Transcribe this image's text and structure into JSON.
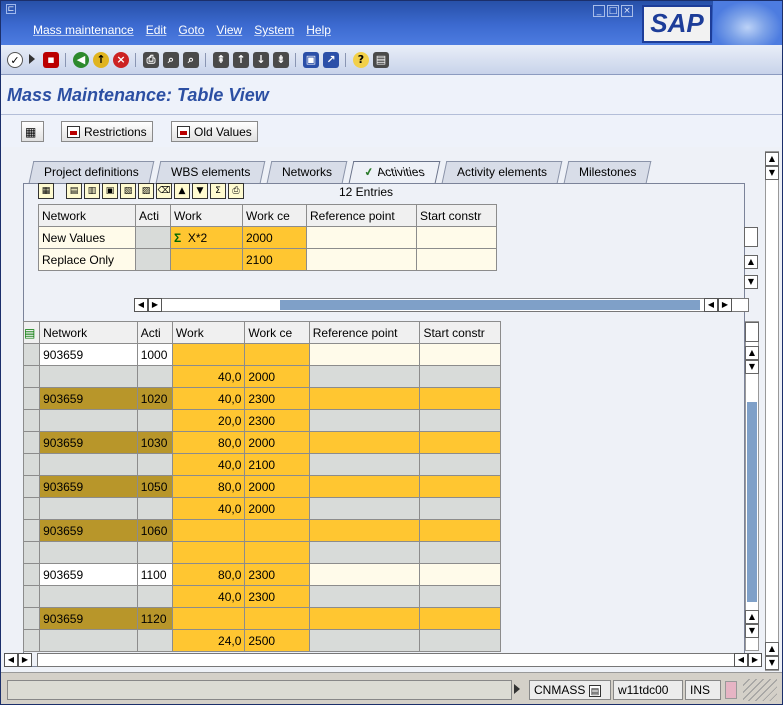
{
  "menu": [
    "Mass maintenance",
    "Edit",
    "Goto",
    "View",
    "System",
    "Help"
  ],
  "brand": "SAP",
  "page_title": "Mass Maintenance: Table View",
  "app_toolbar": {
    "restrictions": "Restrictions",
    "old_values": "Old Values"
  },
  "tabs": [
    "Project definitions",
    "WBS elements",
    "Networks",
    "Activities",
    "Activity elements",
    "Milestones"
  ],
  "active_tab": "Activities",
  "entries_label": "12  Entries",
  "new_values_table": {
    "columns": [
      "Network",
      "Acti",
      "Work",
      "Work ce",
      "Reference point",
      "Start constr"
    ],
    "rows": [
      {
        "label": "New Values",
        "work": "X*2",
        "work_center": "2000"
      },
      {
        "label": "Replace Only",
        "work": "",
        "work_center": "2100"
      }
    ]
  },
  "main_table": {
    "columns": [
      "Network",
      "Acti",
      "Work",
      "Work ce",
      "Reference point",
      "Start constr"
    ],
    "rows": [
      {
        "network": "903659",
        "activity": "1000",
        "work": "",
        "work_center": "",
        "style": "light"
      },
      {
        "network": "",
        "activity": "",
        "work": "40,0",
        "work_center": "2000",
        "style": "gray"
      },
      {
        "network": "903659",
        "activity": "1020",
        "work": "40,0",
        "work_center": "2300",
        "style": "gold"
      },
      {
        "network": "",
        "activity": "",
        "work": "20,0",
        "work_center": "2300",
        "style": "gray"
      },
      {
        "network": "903659",
        "activity": "1030",
        "work": "80,0",
        "work_center": "2000",
        "style": "gold"
      },
      {
        "network": "",
        "activity": "",
        "work": "40,0",
        "work_center": "2100",
        "style": "gray"
      },
      {
        "network": "903659",
        "activity": "1050",
        "work": "80,0",
        "work_center": "2000",
        "style": "gold"
      },
      {
        "network": "",
        "activity": "",
        "work": "40,0",
        "work_center": "2000",
        "style": "gray"
      },
      {
        "network": "903659",
        "activity": "1060",
        "work": "",
        "work_center": "",
        "style": "gold"
      },
      {
        "network": "",
        "activity": "",
        "work": "",
        "work_center": "",
        "style": "gray"
      },
      {
        "network": "903659",
        "activity": "1100",
        "work": "80,0",
        "work_center": "2300",
        "style": "light"
      },
      {
        "network": "",
        "activity": "",
        "work": "40,0",
        "work_center": "2300",
        "style": "gray"
      },
      {
        "network": "903659",
        "activity": "1120",
        "work": "",
        "work_center": "",
        "style": "gold"
      },
      {
        "network": "",
        "activity": "",
        "work": "24,0",
        "work_center": "2500",
        "style": "gray"
      }
    ]
  },
  "status": {
    "transaction": "CNMASS",
    "server": "w11tdc00",
    "mode": "INS"
  }
}
